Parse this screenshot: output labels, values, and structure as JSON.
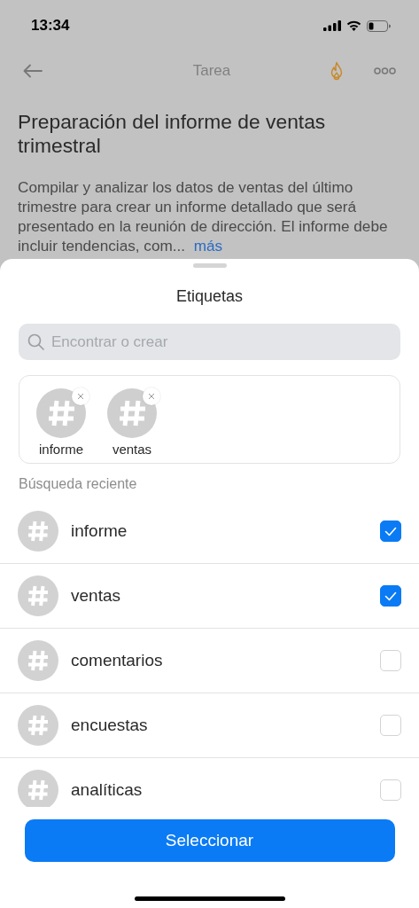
{
  "status_bar": {
    "time": "13:34"
  },
  "nav": {
    "title": "Tarea"
  },
  "task": {
    "title": "Preparación del informe de ventas trimestral",
    "description": "Compilar y analizar los datos de ventas del último trimestre para crear un informe detallado que será presentado en la reunión de dirección. El informe debe incluir tendencias, com...",
    "more": "más"
  },
  "sheet": {
    "title": "Etiquetas",
    "search": {
      "placeholder": "Encontrar o crear"
    },
    "chips": [
      {
        "label": "informe"
      },
      {
        "label": "ventas"
      }
    ],
    "section_label": "Búsqueda reciente",
    "tags": [
      {
        "label": "informe",
        "checked": true
      },
      {
        "label": "ventas",
        "checked": true
      },
      {
        "label": "comentarios",
        "checked": false
      },
      {
        "label": "encuestas",
        "checked": false
      },
      {
        "label": "analíticas",
        "checked": false
      }
    ],
    "button": "Seleccionar"
  }
}
